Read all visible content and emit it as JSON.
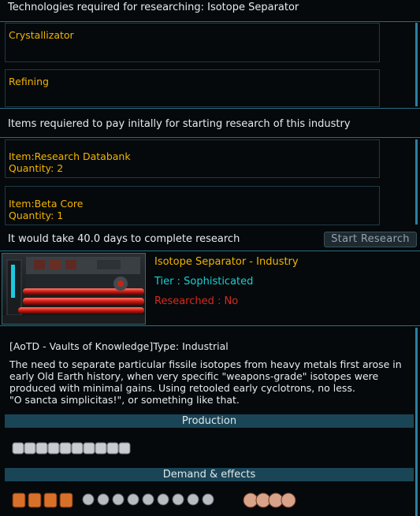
{
  "header": {
    "title": "Technologies required for researching: Isotope Separator"
  },
  "required_techs": [
    {
      "label": "Crystallizator"
    },
    {
      "label": "Refining"
    }
  ],
  "items_header": "Items requiered to pay initally for starting research of this industry",
  "items": [
    {
      "label": "Item:Research Databank",
      "quantity": "Quantity: 2"
    },
    {
      "label": "Item:Beta Core",
      "quantity": "Quantity: 1"
    }
  ],
  "research_time": "It would take 40.0 days to complete research",
  "start_button": "Start Research",
  "industry": {
    "name": "Isotope Separator - Industry",
    "tier": "Tier : Sophisticated",
    "researched": "Researched : No",
    "image_icon": "isotope-separator-image"
  },
  "description": {
    "type_line": "[AoTD - Vaults of Knowledge]Type: Industrial",
    "body": "The need to separate particular fissile isotopes from heavy metals first arose in early Old Earth history, when very specific \"weapons-grade\" isotopes were produced with minimal gains. Using retooled early cyclotrons, no less.",
    "quote": "\"O sancta simplicitas!\", or something like that."
  },
  "sections": {
    "production": "Production",
    "demand": "Demand & effects"
  },
  "production_icons": {
    "icon": "metal-ingot-icon",
    "count": 10
  },
  "demand_icons": [
    {
      "icon": "crew-icon",
      "count": 4
    },
    {
      "icon": "machinery-icon",
      "count": 9
    },
    {
      "icon": "ore-icon",
      "count": 4
    }
  ],
  "colors": {
    "accent": "#2a6d80",
    "gold": "#f1b400",
    "cyan": "#19cfd4",
    "red": "#d62a1f",
    "banner": "#1a4556"
  }
}
